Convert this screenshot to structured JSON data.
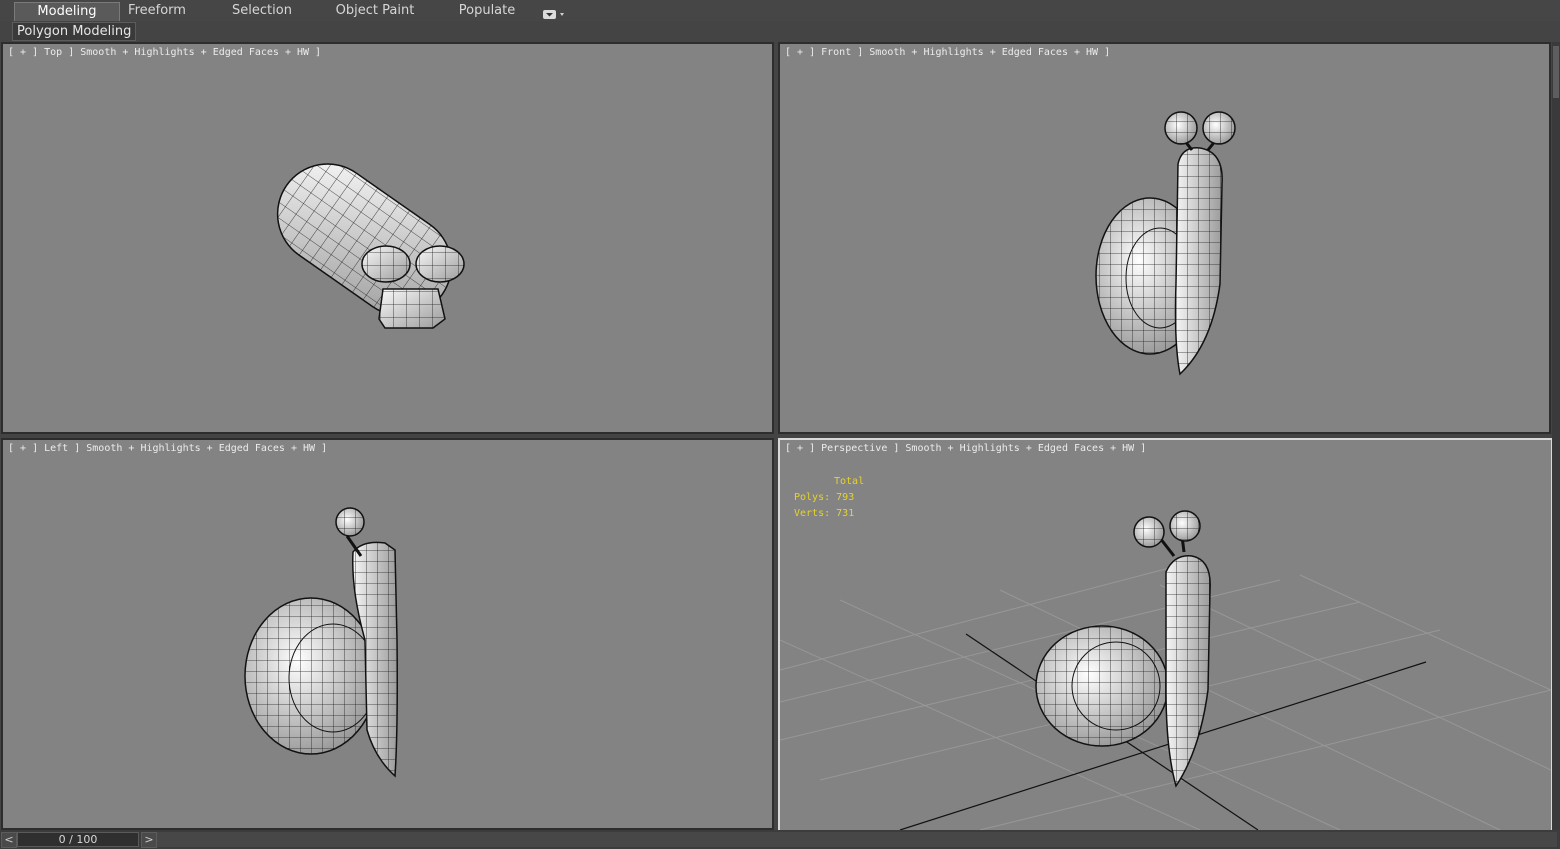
{
  "ribbon": {
    "tabs": [
      {
        "label": "Modeling",
        "active": true
      },
      {
        "label": "Freeform",
        "active": false
      },
      {
        "label": "Selection",
        "active": false
      },
      {
        "label": "Object Paint",
        "active": false
      },
      {
        "label": "Populate",
        "active": false
      }
    ],
    "dropdown_icon": "panel-options-icon"
  },
  "subbar": {
    "panel_label": "Polygon Modeling"
  },
  "viewports": {
    "top": {
      "label": "[ + ] Top ] Smooth + Highlights + Edged Faces + HW ]"
    },
    "front": {
      "label": "[ + ] Front ] Smooth + Highlights + Edged Faces + HW ]"
    },
    "left": {
      "label": "[ + ] Left ] Smooth + Highlights + Edged Faces + HW ]"
    },
    "perspective": {
      "label": "[ + ] Perspective ] Smooth + Highlights + Edged Faces + HW ]",
      "active": true
    }
  },
  "stats": {
    "header": "Total",
    "polys_label": "Polys:",
    "polys_value": "793",
    "verts_label": "Verts:",
    "verts_value": "731"
  },
  "timeline": {
    "frame_label": "0 / 100",
    "prev_label": "<",
    "next_label": ">",
    "current_frame": 0,
    "total_frames": 100
  },
  "colors": {
    "viewport_bg": "#838383",
    "active_border": "#d9d9d9",
    "stats_text": "#e6d32c",
    "ui_bg": "#444444"
  }
}
